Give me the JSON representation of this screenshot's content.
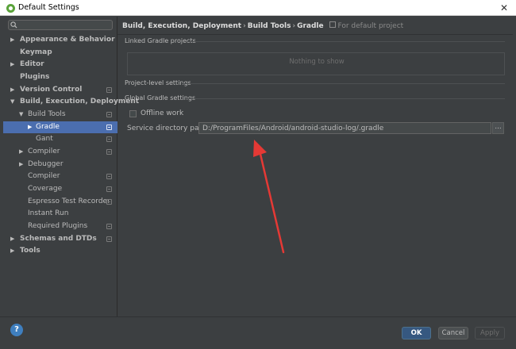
{
  "window": {
    "title": "Default Settings",
    "close_glyph": "✕"
  },
  "search": {
    "value": ""
  },
  "sidebar": {
    "items": [
      {
        "label": "Appearance & Behavior",
        "arrow": "▶",
        "bold": true,
        "config": false
      },
      {
        "label": "Keymap",
        "arrow": "",
        "bold": true,
        "config": false
      },
      {
        "label": "Editor",
        "arrow": "▶",
        "bold": true,
        "config": false
      },
      {
        "label": "Plugins",
        "arrow": "",
        "bold": true,
        "config": false
      },
      {
        "label": "Version Control",
        "arrow": "▶",
        "bold": true,
        "config": true
      },
      {
        "label": "Build, Execution, Deployment",
        "arrow": "▼",
        "bold": true,
        "config": false
      },
      {
        "label": "Build Tools",
        "arrow": "▼",
        "bold": false,
        "config": true
      },
      {
        "label": "Gradle",
        "arrow": "▶",
        "bold": false,
        "config": true,
        "selected": true
      },
      {
        "label": "Gant",
        "arrow": "",
        "bold": false,
        "config": true
      },
      {
        "label": "Compiler",
        "arrow": "▶",
        "bold": false,
        "config": true
      },
      {
        "label": "Debugger",
        "arrow": "▶",
        "bold": false,
        "config": false
      },
      {
        "label": "Compiler",
        "arrow": "",
        "bold": false,
        "config": true
      },
      {
        "label": "Coverage",
        "arrow": "",
        "bold": false,
        "config": true
      },
      {
        "label": "Espresso Test Recorder",
        "arrow": "",
        "bold": false,
        "config": true
      },
      {
        "label": "Instant Run",
        "arrow": "",
        "bold": false,
        "config": false
      },
      {
        "label": "Required Plugins",
        "arrow": "",
        "bold": false,
        "config": true
      },
      {
        "label": "Schemas and DTDs",
        "arrow": "▶",
        "bold": true,
        "config": true
      },
      {
        "label": "Tools",
        "arrow": "▶",
        "bold": true,
        "config": false
      }
    ]
  },
  "breadcrumb": {
    "parts": [
      "Build, Execution, Deployment",
      "Build Tools",
      "Gradle"
    ],
    "separator": "›",
    "scope": "For default project"
  },
  "sections": {
    "linked": "Linked Gradle projects",
    "linked_empty": "Nothing to show",
    "project_level": "Project-level settings",
    "global": "Global Gradle settings"
  },
  "offline_work": {
    "label": "Offline work",
    "checked": false
  },
  "service_directory": {
    "label": "Service directory path:",
    "value": "D:/ProgramFiles/Android/android-studio-log/.gradle",
    "browse_label": "..."
  },
  "buttons": {
    "help": "?",
    "ok": "OK",
    "cancel": "Cancel",
    "apply": "Apply"
  },
  "colors": {
    "accent": "#4b6eaf",
    "annotation": "#e53935",
    "ok": "#365880"
  }
}
